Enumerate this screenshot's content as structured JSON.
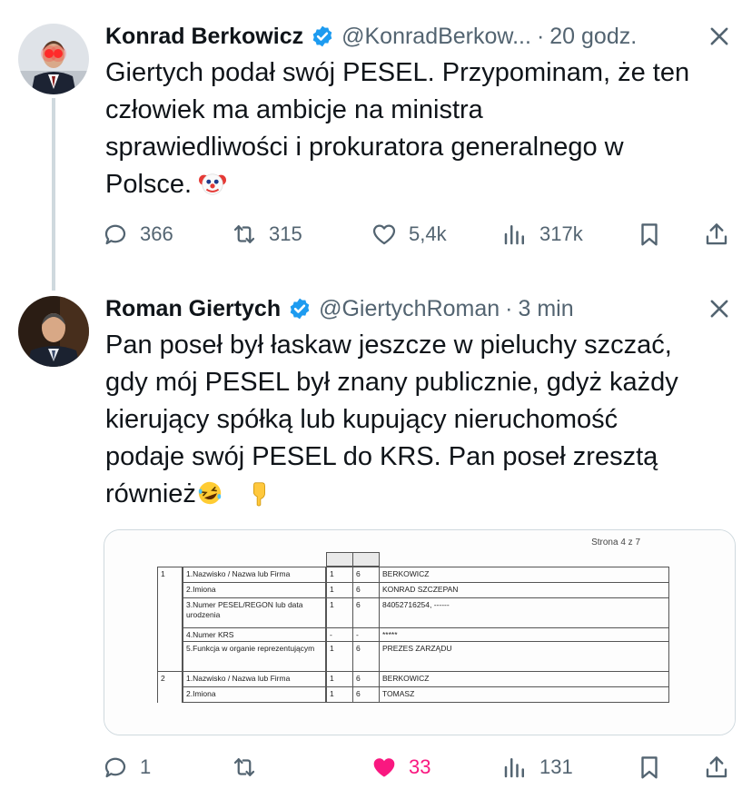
{
  "tweet1": {
    "name": "Konrad Berkowicz",
    "handle": "@KonradBerkow...",
    "separator": "·",
    "time": "20 godz.",
    "text_lines": [
      "Giertych podał swój PESEL. Przypominam, że ten",
      "człowiek ma ambicje na ministra",
      "sprawiedliwości i prokuratora generalnego w",
      "Polsce."
    ],
    "actions": {
      "replies": "366",
      "reposts": "315",
      "likes": "5,4k",
      "views": "317k"
    }
  },
  "tweet2": {
    "name": "Roman Giertych",
    "handle": "@GiertychRoman",
    "separator": "·",
    "time": "3 min",
    "text_lines": [
      "Pan poseł był łaskaw jeszcze w pieluchy szczać,",
      "gdy mój PESEL był znany publicznie, gdyż każdy",
      "kierujący spółką lub kupujący nieruchomość",
      "podaje swój PESEL do KRS. Pan poseł zresztą",
      "również"
    ],
    "actions": {
      "replies": "1",
      "reposts": "",
      "likes": "33",
      "views": "131"
    }
  },
  "document": {
    "page": "Strona 4 z 7",
    "rows": [
      {
        "num": "1",
        "label": "1.Nazwisko / Nazwa lub Firma",
        "c1": "1",
        "c2": "6",
        "value": "BERKOWICZ"
      },
      {
        "num": "",
        "label": "2.Imiona",
        "c1": "1",
        "c2": "6",
        "value": "KONRAD SZCZEPAN"
      },
      {
        "num": "",
        "label": "3.Numer PESEL/REGON lub data urodzenia",
        "c1": "1",
        "c2": "6",
        "value": "84052716254, ------"
      },
      {
        "num": "",
        "label": "4.Numer KRS",
        "c1": "-",
        "c2": "-",
        "value": "*****"
      },
      {
        "num": "",
        "label": "5.Funkcja w organie reprezentującym",
        "c1": "1",
        "c2": "6",
        "value": "PREZES ZARZĄDU"
      },
      {
        "num": "2",
        "label": "1.Nazwisko / Nazwa lub Firma",
        "c1": "1",
        "c2": "6",
        "value": "BERKOWICZ"
      },
      {
        "num": "",
        "label": "2.Imiona",
        "c1": "1",
        "c2": "6",
        "value": "TOMASZ"
      }
    ]
  },
  "colors": {
    "text": "#0f1419",
    "secondary": "#536471",
    "verified": "#1d9bf0",
    "like": "#f91880",
    "border": "#cfd9de"
  }
}
